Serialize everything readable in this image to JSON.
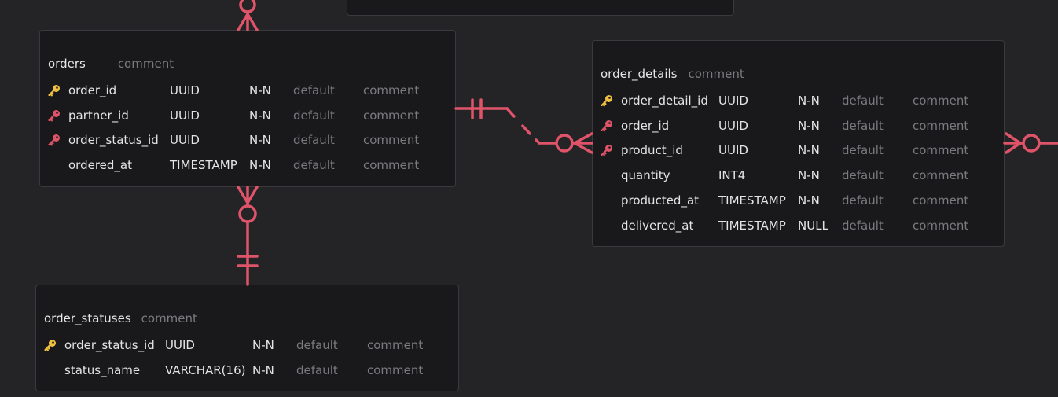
{
  "colors": {
    "background": "#242427",
    "table_bg": "#19191b",
    "edge": "#e0546a",
    "primary_key": "#f0c040",
    "foreign_key": "#e0546a"
  },
  "tables": {
    "orders": {
      "name": "orders",
      "comment": "comment",
      "columns": [
        {
          "key": "primary-key-icon",
          "name": "order_id",
          "type": "UUID",
          "null": "N-N",
          "default": "default",
          "comment": "comment"
        },
        {
          "key": "foreign-key-icon",
          "name": "partner_id",
          "type": "UUID",
          "null": "N-N",
          "default": "default",
          "comment": "comment"
        },
        {
          "key": "foreign-key-icon",
          "name": "order_status_id",
          "type": "UUID",
          "null": "N-N",
          "default": "default",
          "comment": "comment"
        },
        {
          "key": "",
          "name": "ordered_at",
          "type": "TIMESTAMP",
          "null": "N-N",
          "default": "default",
          "comment": "comment"
        }
      ]
    },
    "order_details": {
      "name": "order_details",
      "comment": "comment",
      "columns": [
        {
          "key": "primary-key-icon",
          "name": "order_detail_id",
          "type": "UUID",
          "null": "N-N",
          "default": "default",
          "comment": "comment"
        },
        {
          "key": "foreign-key-icon",
          "name": "order_id",
          "type": "UUID",
          "null": "N-N",
          "default": "default",
          "comment": "comment"
        },
        {
          "key": "foreign-key-icon",
          "name": "product_id",
          "type": "UUID",
          "null": "N-N",
          "default": "default",
          "comment": "comment"
        },
        {
          "key": "",
          "name": "quantity",
          "type": "INT4",
          "null": "N-N",
          "default": "default",
          "comment": "comment"
        },
        {
          "key": "",
          "name": "producted_at",
          "type": "TIMESTAMP",
          "null": "N-N",
          "default": "default",
          "comment": "comment"
        },
        {
          "key": "",
          "name": "delivered_at",
          "type": "TIMESTAMP",
          "null": "NULL",
          "default": "default",
          "comment": "comment"
        }
      ]
    },
    "order_statuses": {
      "name": "order_statuses",
      "comment": "comment",
      "columns": [
        {
          "key": "primary-key-icon",
          "name": "order_status_id",
          "type": "UUID",
          "null": "N-N",
          "default": "default",
          "comment": "comment"
        },
        {
          "key": "",
          "name": "status_name",
          "type": "VARCHAR(16)",
          "null": "N-N",
          "default": "default",
          "comment": "comment"
        }
      ]
    }
  },
  "relationships": [
    {
      "from": "orders",
      "to": "order_details",
      "from_end": "one-and-only-one",
      "to_end": "zero-or-many",
      "line": "dashed"
    },
    {
      "from": "order_statuses",
      "to": "orders",
      "from_end": "one-and-only-one",
      "to_end": "zero-or-many",
      "line": "solid"
    }
  ]
}
